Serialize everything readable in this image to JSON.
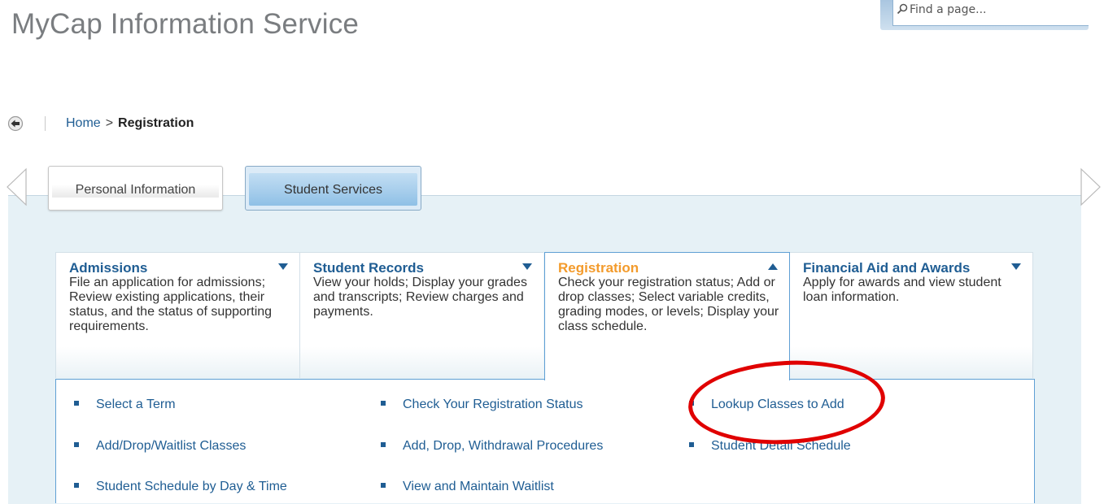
{
  "header": {
    "title": "MyCap Information Service"
  },
  "search": {
    "placeholder": "Find a page..."
  },
  "breadcrumb": {
    "home": "Home",
    "separator": ">",
    "current": "Registration"
  },
  "tabs": [
    {
      "label": "Personal Information",
      "active": false
    },
    {
      "label": "Student Services",
      "active": true
    }
  ],
  "categories": [
    {
      "title": "Admissions",
      "description": "File an application for admissions; Review existing applications, their status, and the status of supporting requirements.",
      "expanded": false
    },
    {
      "title": "Student Records",
      "description": "View your holds; Display your grades and transcripts; Review charges and payments.",
      "expanded": false
    },
    {
      "title": "Registration",
      "description": "Check your registration status; Add or drop classes; Select variable credits, grading modes, or levels; Display your class schedule.",
      "expanded": true
    },
    {
      "title": "Financial Aid and Awards",
      "description": "Apply for awards and view student loan information.",
      "expanded": false
    }
  ],
  "registration_links": [
    {
      "label": "Select a Term"
    },
    {
      "label": "Check Your Registration Status"
    },
    {
      "label": "Lookup Classes to Add"
    },
    {
      "label": "Add/Drop/Waitlist Classes"
    },
    {
      "label": "Add, Drop, Withdrawal Procedures"
    },
    {
      "label": "Student Detail Schedule"
    },
    {
      "label": "Student Schedule by Day & Time"
    },
    {
      "label": "View and Maintain Waitlist"
    }
  ],
  "colors": {
    "link": "#1f5d93",
    "active_category_title": "#f39b2c",
    "title_gray": "#7a7d80",
    "annotation": "#e00000",
    "panel_bg": "#e6f1f6"
  }
}
